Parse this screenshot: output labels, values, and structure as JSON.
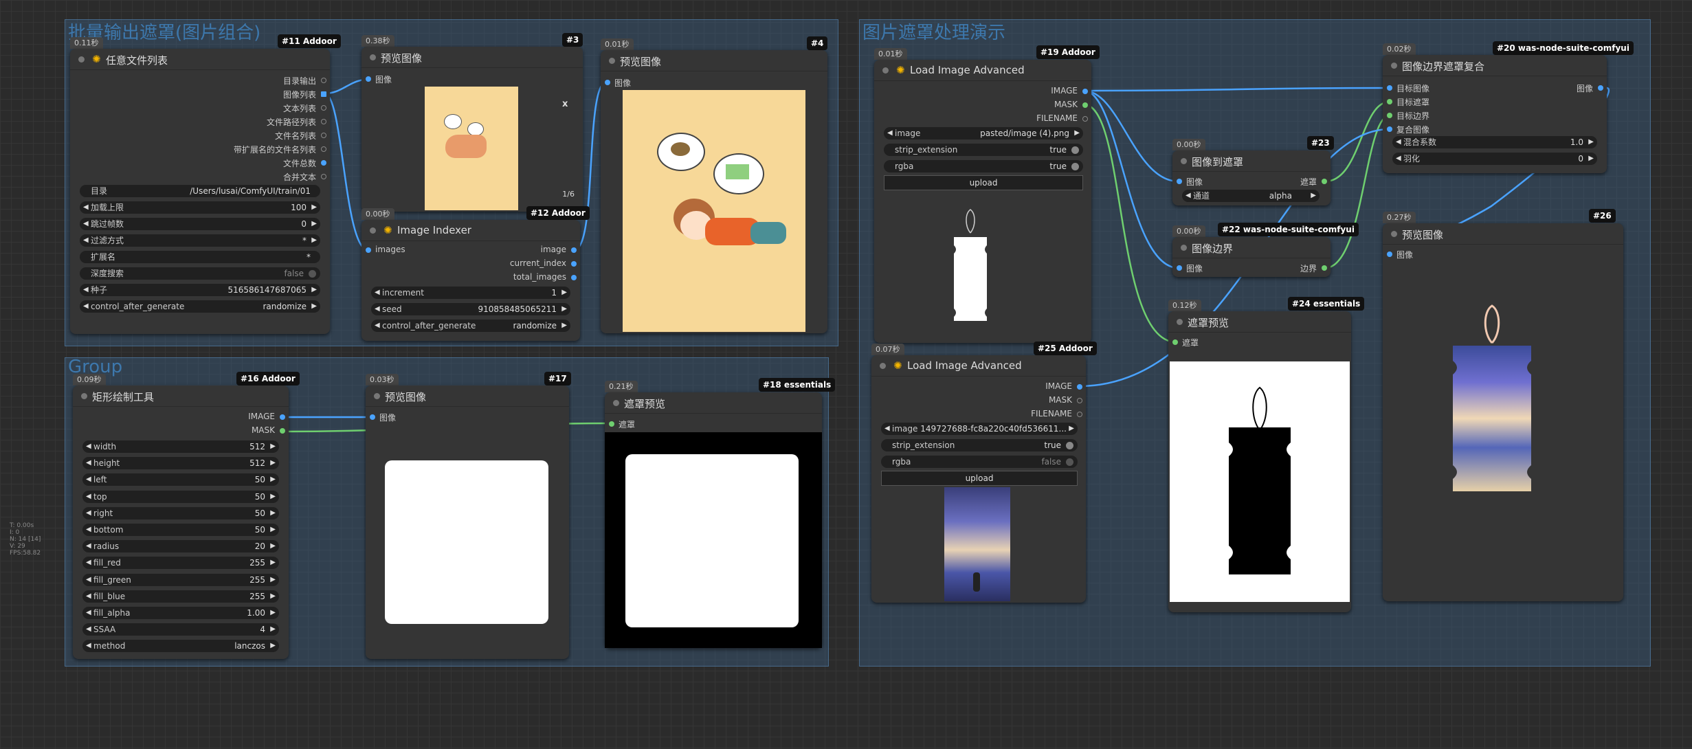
{
  "groups": {
    "g1": "批量输出遮罩(图片组合)",
    "g2": "Group",
    "g3": "图片遮罩处理演示"
  },
  "colors": {
    "link_image": "#4aa3ff",
    "link_mask": "#6fcf6f",
    "accent": "#f3b400"
  },
  "n11": {
    "timing": "0.11秒",
    "badge": "#11 Addoor",
    "title": "任意文件列表",
    "outputs": [
      "目录输出",
      "图像列表",
      "文本列表",
      "文件路径列表",
      "文件名列表",
      "带扩展名的文件名列表",
      "文件总数",
      "合并文本"
    ],
    "widgets": [
      {
        "label": "目录",
        "value": "/Users/lusai/ComfyUI/train/01"
      },
      {
        "label": "加载上限",
        "value": "100"
      },
      {
        "label": "跳过帧数",
        "value": "0"
      },
      {
        "label": "过滤方式",
        "value": "*"
      },
      {
        "label": "扩展名",
        "value": "*"
      },
      {
        "label": "深度搜索",
        "value": "false"
      },
      {
        "label": "种子",
        "value": "516586147687065"
      },
      {
        "label": "control_after_generate",
        "value": "randomize"
      }
    ]
  },
  "n3": {
    "timing": "0.38秒",
    "badge": "#3",
    "title": "预览图像",
    "input": "图像",
    "close": "x",
    "counter": "1/6"
  },
  "n4": {
    "timing": "0.01秒",
    "badge": "#4",
    "title": "预览图像",
    "input": "图像"
  },
  "n12": {
    "timing": "0.00秒",
    "badge": "#12 Addoor",
    "title": "Image Indexer",
    "input": "images",
    "outputs": [
      "image",
      "current_index",
      "total_images"
    ],
    "widgets": [
      {
        "label": "increment",
        "value": "1"
      },
      {
        "label": "seed",
        "value": "910858485065211"
      },
      {
        "label": "control_after_generate",
        "value": "randomize"
      }
    ]
  },
  "n16": {
    "timing": "0.09秒",
    "badge": "#16 Addoor",
    "title": "矩形绘制工具",
    "outputs": [
      "IMAGE",
      "MASK"
    ],
    "widgets": [
      {
        "label": "width",
        "value": "512"
      },
      {
        "label": "height",
        "value": "512"
      },
      {
        "label": "left",
        "value": "50"
      },
      {
        "label": "top",
        "value": "50"
      },
      {
        "label": "right",
        "value": "50"
      },
      {
        "label": "bottom",
        "value": "50"
      },
      {
        "label": "radius",
        "value": "20"
      },
      {
        "label": "fill_red",
        "value": "255"
      },
      {
        "label": "fill_green",
        "value": "255"
      },
      {
        "label": "fill_blue",
        "value": "255"
      },
      {
        "label": "fill_alpha",
        "value": "1.00"
      },
      {
        "label": "SSAA",
        "value": "4"
      },
      {
        "label": "method",
        "value": "lanczos"
      }
    ]
  },
  "n17": {
    "timing": "0.03秒",
    "badge": "#17",
    "title": "预览图像",
    "input": "图像"
  },
  "n18": {
    "timing": "0.21秒",
    "badge": "#18 essentials",
    "title": "遮罩预览",
    "input": "遮罩"
  },
  "n19": {
    "timing": "0.01秒",
    "badge": "#19 Addoor",
    "title": "Load Image Advanced",
    "outputs": [
      "IMAGE",
      "MASK",
      "FILENAME"
    ],
    "widgets": [
      {
        "label": "image",
        "value": "pasted/image (4).png"
      },
      {
        "label": "strip_extension",
        "value": "true"
      },
      {
        "label": "rgba",
        "value": "true"
      }
    ],
    "upload": "upload"
  },
  "n25": {
    "timing": "0.07秒",
    "badge": "#25 Addoor",
    "title": "Load Image Advanced",
    "outputs": [
      "IMAGE",
      "MASK",
      "FILENAME"
    ],
    "widgets": [
      {
        "label": "image",
        "value": "149727688-fc8a220c40fd536611..."
      },
      {
        "label": "strip_extension",
        "value": "true"
      },
      {
        "label": "rgba",
        "value": "false"
      }
    ],
    "upload": "upload"
  },
  "n23": {
    "timing": "0.00秒",
    "badge": "#23",
    "title": "图像到遮罩",
    "input": "图像",
    "output": "遮罩",
    "widget": {
      "label": "通道",
      "value": "alpha"
    }
  },
  "n22": {
    "timing": "0.00秒",
    "badge": "#22 was-node-suite-comfyui",
    "title": "图像边界",
    "input": "图像",
    "output": "边界"
  },
  "n24": {
    "timing": "0.12秒",
    "badge": "#24 essentials",
    "title": "遮罩预览",
    "input": "遮罩"
  },
  "n20": {
    "timing": "0.02秒",
    "badge": "#20 was-node-suite-comfyui",
    "title": "图像边界遮罩复合",
    "inputs": [
      "目标图像",
      "目标遮罩",
      "目标边界",
      "复合图像"
    ],
    "output": "图像",
    "widgets": [
      {
        "label": "混合系数",
        "value": "1.0"
      },
      {
        "label": "羽化",
        "value": "0"
      }
    ]
  },
  "n26": {
    "timing": "0.27秒",
    "badge": "#26",
    "title": "预览图像",
    "input": "图像"
  },
  "stats": [
    "T: 0.00s",
    "I: 0",
    "N: 14 [14]",
    "V: 29",
    "FPS:58.82"
  ]
}
